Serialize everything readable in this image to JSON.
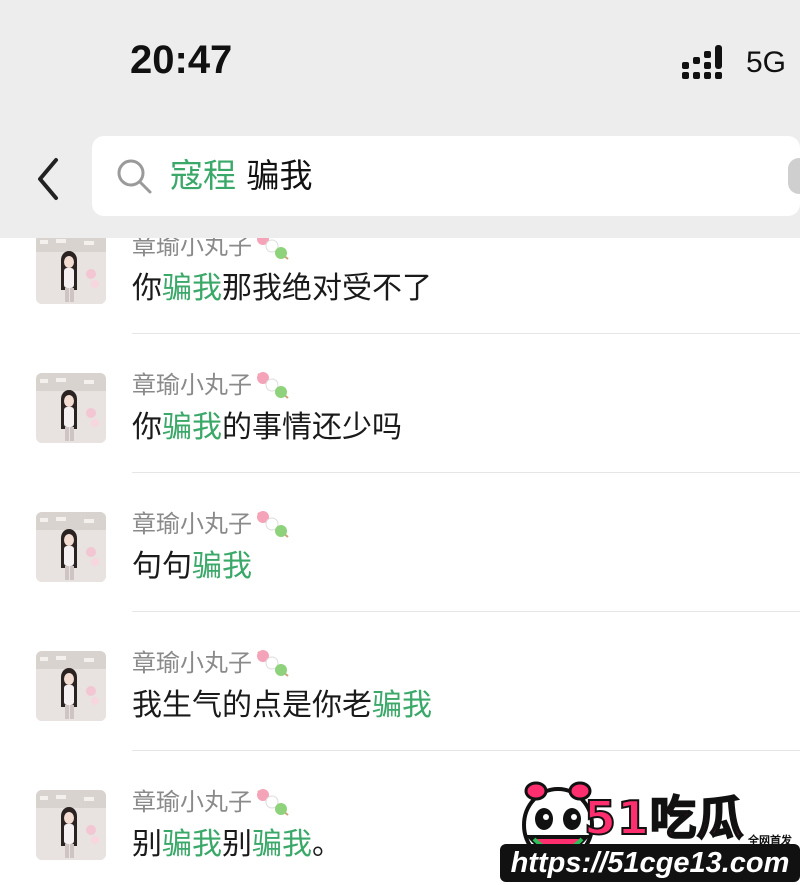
{
  "status_bar": {
    "time": "20:47",
    "network": "5G"
  },
  "search": {
    "keyword_highlight": "寇程",
    "keyword_rest": " 骗我"
  },
  "results": [
    {
      "sender": "章瑜小丸子",
      "parts": [
        {
          "t": "你",
          "h": false
        },
        {
          "t": "骗我",
          "h": true
        },
        {
          "t": "那我绝对受不了",
          "h": false
        }
      ]
    },
    {
      "sender": "章瑜小丸子",
      "parts": [
        {
          "t": "你",
          "h": false
        },
        {
          "t": "骗我",
          "h": true
        },
        {
          "t": "的事情还少吗",
          "h": false
        }
      ]
    },
    {
      "sender": "章瑜小丸子",
      "parts": [
        {
          "t": "句句",
          "h": false
        },
        {
          "t": "骗我",
          "h": true
        }
      ]
    },
    {
      "sender": "章瑜小丸子",
      "parts": [
        {
          "t": "我生气的点是你老",
          "h": false
        },
        {
          "t": "骗我",
          "h": true
        }
      ]
    },
    {
      "sender": "章瑜小丸子",
      "parts": [
        {
          "t": "别",
          "h": false
        },
        {
          "t": "骗我",
          "h": true
        },
        {
          "t": "别",
          "h": false
        },
        {
          "t": "骗我",
          "h": true
        },
        {
          "t": "。",
          "h": false
        }
      ]
    }
  ],
  "watermark": {
    "logo": "51吃瓜",
    "tag": "全网首发",
    "url": "https://51cge13.com"
  },
  "colors": {
    "highlight": "#3aa868",
    "background_bar": "#ededed"
  },
  "icons": {
    "back": "chevron-left-icon",
    "search": "search-icon",
    "signal": "signal-bars-icon",
    "emoji": "dango-emoji-icon"
  }
}
